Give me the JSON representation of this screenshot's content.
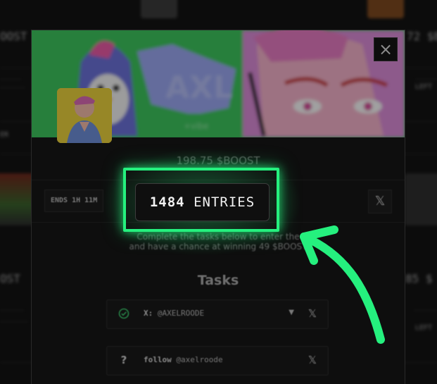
{
  "background": {
    "left_tag_top": "OOST",
    "right_tag_top": "72 $B",
    "left_tag_mid": "OST",
    "right_tag_mid": "85 $",
    "left_side_label": "ER",
    "right_side_label_a": "LEFT",
    "right_side_label_b": "LEFT"
  },
  "modal": {
    "close_label": "×",
    "prize_text": "198.75 $BOOST",
    "ends_text": "ENDS 1H 11M",
    "entries": {
      "count": "1484",
      "label": "ENTRIES"
    },
    "share_x_label": "𝕏",
    "description_line1": "Complete the tasks below to enter the",
    "description_line2": "and have a chance at winning 49 $BOOST",
    "tasks_title": "Tasks",
    "tasks": [
      {
        "status_icon": "check-circle-icon",
        "prefix": "X:",
        "handle": "@AXELROODE",
        "has_caret": true,
        "x_label": "𝕏"
      },
      {
        "status_icon": "question-icon",
        "prefix": "follow",
        "handle": "@axelroode",
        "has_caret": false,
        "x_label": "𝕏"
      }
    ]
  },
  "banner": {
    "logo_text": "AXL",
    "sub_text": "+vibe"
  },
  "colors": {
    "highlight": "#25f07e",
    "banner_green": "#39c25a",
    "modal_bg": "#161616",
    "page_bg": "#0c0c0c"
  }
}
